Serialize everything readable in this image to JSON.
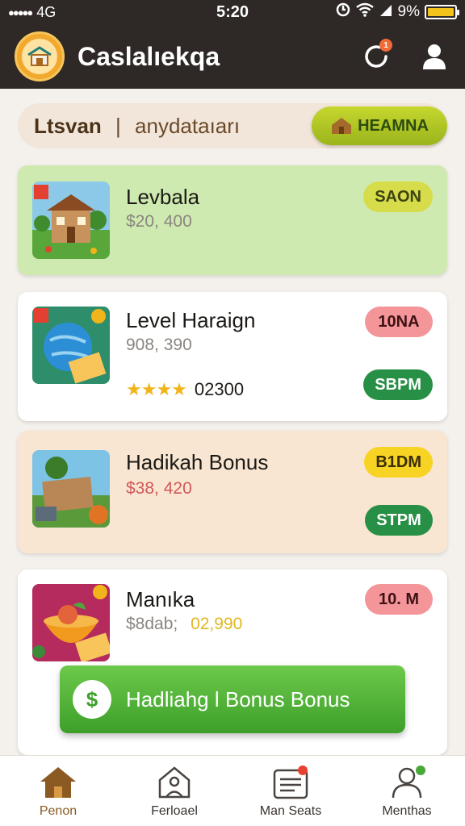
{
  "status_bar": {
    "signal": "●●●●●",
    "carrier": "4G",
    "time": "5:20",
    "battery": "9%",
    "battery_color": "#f3c31b"
  },
  "header": {
    "app_title": "Caslalıekqa",
    "background": "#2e2826",
    "notification_icon": "refresh-alert-icon",
    "notification_count": "1",
    "profile_icon": "user-icon"
  },
  "filter": {
    "label_left": "Ltsvan",
    "separator": "|",
    "label_right": "anydataıarı",
    "premium_label": "HEAMNA",
    "premium_icon": "house-icon"
  },
  "cards": [
    {
      "title": "Levbala",
      "price": "$20, 400",
      "badge": "SAON",
      "thumb_icon": "house-illustration"
    },
    {
      "title": "Level Haraign",
      "price": "908, 390",
      "badge": "10NA",
      "rating": "02300",
      "stars": "★★★★",
      "action": "SBPM",
      "thumb_icon": "globe-illustration"
    },
    {
      "title": "Hadikah Bonus",
      "price": "$38, 420",
      "badge": "B1DM",
      "action": "STPM",
      "thumb_icon": "chest-illustration"
    },
    {
      "title": "Manıka",
      "price_prefix": "$8dab;",
      "price": "02,990",
      "badge": "10. M",
      "thumb_icon": "fruit-bowl-illustration"
    }
  ],
  "bonus_button": {
    "label": "Hadliahg l Bonus Bonus",
    "icon": "dollar-bag-icon"
  },
  "tabs": [
    {
      "label": "Penon",
      "icon": "home-icon",
      "active": true
    },
    {
      "label": "Ferloael",
      "icon": "house-outline-icon",
      "active": false
    },
    {
      "label": "Man Seats",
      "icon": "list-icon",
      "active": false
    },
    {
      "label": "Menthas",
      "icon": "person-icon",
      "active": false
    }
  ]
}
